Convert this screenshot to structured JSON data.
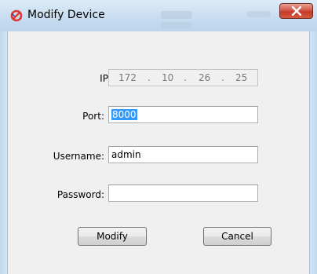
{
  "window": {
    "title": "Modify Device",
    "close_symbol": "x"
  },
  "form": {
    "ip": {
      "label": "IP:",
      "octets": [
        "172",
        "10",
        "26",
        "25"
      ],
      "separator": "."
    },
    "port": {
      "label": "Port:",
      "value": "8000"
    },
    "username": {
      "label": "Username:",
      "value": "admin"
    },
    "password": {
      "label": "Password:",
      "value": ""
    }
  },
  "buttons": {
    "modify": "Modify",
    "cancel": "Cancel"
  },
  "colors": {
    "close_button": "#c43a2a",
    "selection": "#3399ff",
    "title_icon": "#e0352b"
  },
  "icons": {
    "title": "app-logo-icon",
    "close": "close-icon"
  }
}
